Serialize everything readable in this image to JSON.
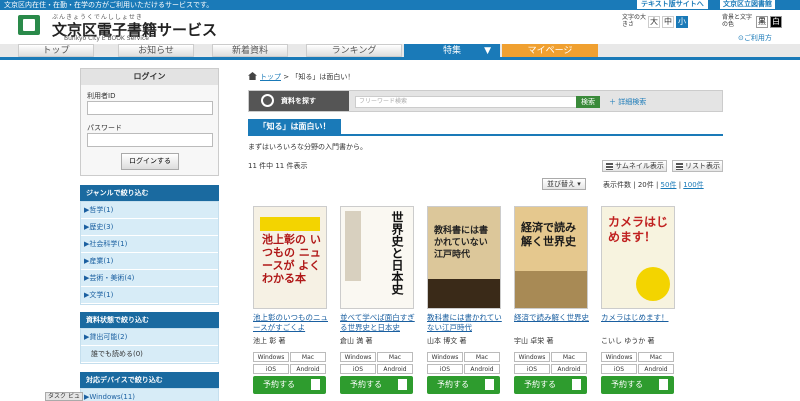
{
  "topbar": {
    "message": "文京区内在住・在勤・在学の方がご利用いただけるサービスです。",
    "text_site": "テキスト版サイトへ",
    "library_link": "文京区立図書館"
  },
  "header": {
    "ruby": "ぶんきょうくでんししょせき",
    "title": "文京区電子書籍サービス",
    "subtitle": "Bunkyo City E BOOK Service",
    "size_label": "文字の大きさ",
    "size_large": "大",
    "size_medium": "中",
    "size_small": "小",
    "color_label": "背景と文字の色",
    "color_black": "黒",
    "color_white": "白",
    "help": "ご利用方"
  },
  "nav": {
    "top": "トップ",
    "news": "お知らせ",
    "new_books": "新着資料",
    "ranking": "ランキング",
    "special": "特集",
    "mypage": "マイページ"
  },
  "login": {
    "heading": "ログイン",
    "user_id_label": "利用者ID",
    "password_label": "パスワード",
    "button": "ログインする"
  },
  "genre": {
    "heading": "ジャンルで絞り込む",
    "items": [
      "▶哲学(1)",
      "▶歴史(3)",
      "▶社会科学(1)",
      "▶産業(1)",
      "▶芸術・美術(4)",
      "▶文学(1)"
    ]
  },
  "status": {
    "heading": "資料状態で絞り込む",
    "items": [
      "▶貸出可能(2)",
      "誰でも読める(0)"
    ]
  },
  "device": {
    "heading": "対応デバイスで絞り込む",
    "items": [
      "▶Windows(11)"
    ]
  },
  "breadcrumb": {
    "top": "トップ",
    "sep": ">",
    "current": "「知る」は面白い！"
  },
  "search": {
    "button": "資料を探す",
    "placeholder": "フリーワード検索",
    "go": "検索",
    "advanced": "詳細検索"
  },
  "feature": {
    "tab": "「知る」は面白い！",
    "description": "まずはいろいろな分野の入門書から。",
    "count": "11 件中 11 件表示",
    "thumb_view": "サムネイル表示",
    "list_view": "リスト表示",
    "sort": "並び替え",
    "per_page_label": "表示件数",
    "per_20": "20件",
    "per_50": "50件",
    "per_100": "100件"
  },
  "books": [
    {
      "title": "池上彰のいつものニュースがすごくよ",
      "author": "池上 彰 著",
      "cover_text": "池上彰の いつもの ニュースが よくわかる本",
      "cover_bg": "#f6f1e4"
    },
    {
      "title": "並べて学べば面白すぎる世界史と日本史",
      "author": "倉山 満 著",
      "cover_text": "世界史と日本史",
      "cover_bg": "#faf8f2"
    },
    {
      "title": "教科書には書かれていない江戸時代",
      "author": "山本 博文 著",
      "cover_text": "教科書には書かれていない江戸時代",
      "cover_bg": "#dcc79a"
    },
    {
      "title": "経済で読み解く世界史",
      "author": "宇山 卓栄 著",
      "cover_text": "経済で読み解く世界史",
      "cover_bg": "#e5c88e"
    },
    {
      "title": "カメラはじめます！",
      "author": "こいし ゆうか 著",
      "cover_text": "カメラはじめます！",
      "cover_bg": "#f7f3df"
    }
  ],
  "book_labels": {
    "windows": "Windows",
    "mac": "Mac",
    "ios": "iOS",
    "android": "Android",
    "reserve": "予約する"
  },
  "taskbar": "タスク ビュー"
}
